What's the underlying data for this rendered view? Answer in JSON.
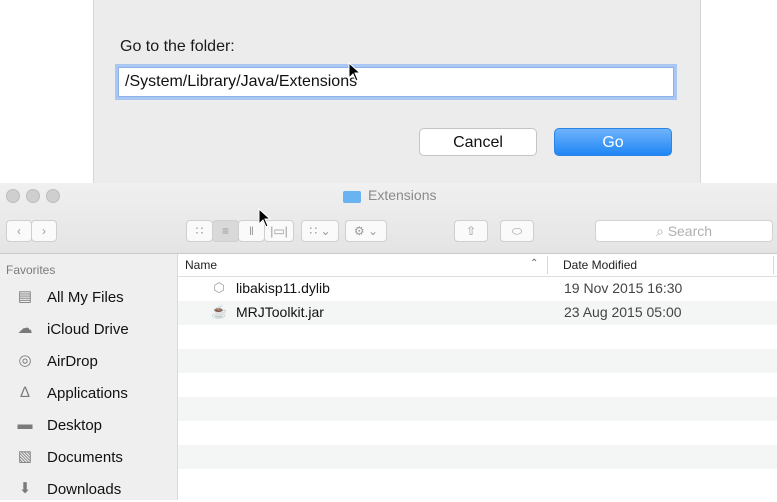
{
  "dialog": {
    "prompt": "Go to the folder:",
    "path_value": "/System/Library/Java/Extensions",
    "cancel_label": "Cancel",
    "go_label": "Go",
    "accent_color": "#1f86f5"
  },
  "finder": {
    "window_title": "Extensions",
    "search_placeholder": "Search",
    "toolbar": {
      "back_icon": "chevron-left-icon",
      "forward_icon": "chevron-right-icon",
      "view_modes": [
        "icon-view-icon",
        "list-view-icon",
        "column-view-icon",
        "coverflow-view-icon"
      ],
      "selected_view": "list-view-icon",
      "arrange_icon": "arrange-icon",
      "action_icon": "gear-icon",
      "share_icon": "share-icon",
      "tags_icon": "tag-icon"
    },
    "sidebar": {
      "heading": "Favorites",
      "items": [
        {
          "label": "All My Files",
          "icon": "all-files-icon"
        },
        {
          "label": "iCloud Drive",
          "icon": "cloud-icon"
        },
        {
          "label": "AirDrop",
          "icon": "airdrop-icon"
        },
        {
          "label": "Applications",
          "icon": "applications-icon"
        },
        {
          "label": "Desktop",
          "icon": "desktop-icon"
        },
        {
          "label": "Documents",
          "icon": "documents-icon"
        },
        {
          "label": "Downloads",
          "icon": "downloads-icon"
        }
      ]
    },
    "columns": {
      "name": "Name",
      "date": "Date Modified"
    },
    "files": [
      {
        "name": "libakisp11.dylib",
        "date": "19 Nov 2015 16:30",
        "icon": "dylib-file-icon"
      },
      {
        "name": "MRJToolkit.jar",
        "date": "23 Aug 2015 05:00",
        "icon": "jar-file-icon"
      }
    ]
  }
}
